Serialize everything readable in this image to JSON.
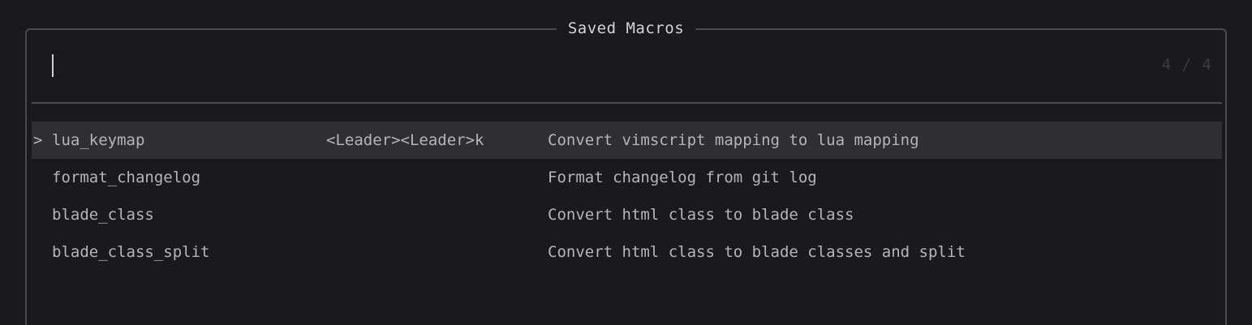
{
  "picker": {
    "title": "Saved Macros",
    "query": "",
    "match_count": "4 / 4",
    "selection_marker": ">",
    "items": [
      {
        "name": "lua_keymap",
        "keys": "<Leader><Leader>k",
        "description": "Convert vimscript mapping to lua mapping",
        "selected": true
      },
      {
        "name": "format_changelog",
        "keys": "",
        "description": "Format changelog from git log",
        "selected": false
      },
      {
        "name": "blade_class",
        "keys": "",
        "description": "Convert html class to blade class",
        "selected": false
      },
      {
        "name": "blade_class_split",
        "keys": "",
        "description": "Convert html class to blade classes and split",
        "selected": false
      }
    ]
  }
}
